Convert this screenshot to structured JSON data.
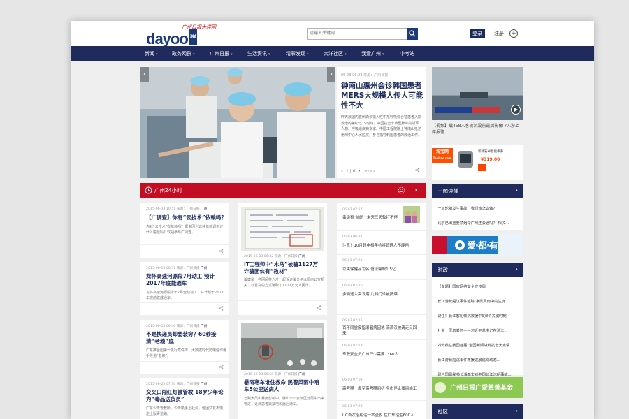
{
  "header": {
    "logo_top": "广州日报大洋网",
    "logo_main": "dayoo",
    "logo_badge": "测试",
    "search_placeholder": "请输入关键词...",
    "login_label": "登录",
    "register_label": "注册"
  },
  "nav": {
    "items": [
      {
        "label": "新闻",
        "dropdown": true
      },
      {
        "label": "政务网群",
        "dropdown": true
      },
      {
        "label": "广州日报",
        "dropdown": true
      },
      {
        "label": "生活资讯",
        "dropdown": true
      },
      {
        "label": "精彩发现",
        "dropdown": true
      },
      {
        "label": "大洋社区",
        "dropdown": true
      },
      {
        "label": "我爱广州",
        "dropdown": true
      },
      {
        "label": "中考站",
        "dropdown": false
      }
    ]
  },
  "feature": {
    "meta": "06-03 06:33 来源：广州日报",
    "headline": "钟南山惠州会诊韩国患者 MERS大规模人传人可能性不大",
    "summary": "昨天晨国内首例确诊输入性中东呼吸综合征患者入院救治的第6天。9时许，中国抗击非典型肺炎的领军人物、呼吸道疾病专家、中国工程院院士钟南山抵达惠州中心人民医院，参与指导韩国患者的救治工作。",
    "pager_current": "1",
    "pager_sep": "|",
    "pager_total": "6",
    "more_label": "more"
  },
  "video": {
    "caption": "【视频】载458人客轮沉没前最后影像 7人游上岸报警",
    "ad_brand": "淘宝网",
    "ad_domain": "Taobao.com",
    "ad_text": "新款安卓智能手表 ",
    "ad_price": "¥319.00"
  },
  "guangzhou24": {
    "title": "广州24小时",
    "cards": [
      {
        "meta": "2015-06-03 10:51 来源：广州日报",
        "badge": "广州",
        "title": "【广调查】你有“云技术”依赖吗？",
        "summary": "你对“云技术”有依赖吗？据说因为这种依赖遇到过什么尴尬吗？欢迎参与广调查。"
      },
      {
        "meta": "2015-06-03 06:57 来源：广州日报",
        "badge": "广州",
        "title": "龙怀高速河源段7月动工 预计2017年底能通车",
        "summary": "龙怀高速河源段今年7月全线动工，并计划于2017年底前建成通车。"
      },
      {
        "meta": "2015-06-03 06:46 来源：广州日报",
        "badge": "广州",
        "title": "不是快递员却要装穷？60秒接清“老赖”底",
        "summary": "广东推全国第一执行案件库，大数据时代防电信诈骗手段追“老赖”。"
      },
      {
        "meta": "2015-06-03 07:30 来源：广州日报",
        "badge": "广州",
        "title": "交叉口闯红灯被管教 18岁少年论为“毒品送货员”",
        "summary": "广东少年管教所，少年吸手上社会，他因交友不慎，走上贩毒道路。"
      }
    ],
    "photo_cards": [
      {
        "meta": "2015-06-03 06:42 来源：广州日报",
        "badge": "广州",
        "title": "IT工程师中“木马”被骗1127万 诈骗团伙有“教材”",
        "summary": "骗案是一名网民挂人才，起诉诈骗分子以国内公安机关，以冒充的方式骗取了1127万元人民币。"
      },
      {
        "meta": "2015-06-03 06:58 来源：广州日报",
        "badge": "广州",
        "title": "暴雨寒车谁住救命 民警风雨中哨车5公里送病人",
        "summary": "七贼大风和暴雨影响中，佛山市公安城区分局车出来管进，让病患者紧紧地和此后通车。"
      }
    ],
    "brief_items": [
      {
        "date": "06-03 07:17",
        "text": "雷锋有“加班” 未来三天较打不停"
      },
      {
        "date": "06-03 06:37",
        "text": "注意！10月起电梯年检将管理人不能用"
      },
      {
        "date": "06-03 07:28",
        "text": "以夹保健品为名 信法骗取1.5亿"
      },
      {
        "date": "06-03 07:26",
        "text": "多辆违入高发期 儿科门诊被挤爆"
      },
      {
        "date": "06-03 07:25",
        "text": "百年同堂废指滚者病因地 流浪汉被请走又回来"
      },
      {
        "date": "06-03 07:23",
        "text": "专职安全员广州三少需要1360人"
      },
      {
        "date": "06-03 07:09",
        "text": "高考期一周至高考期间初 全市停止夜间施工"
      },
      {
        "date": "06-03 07:08",
        "text": "UC首次借期达一本垄胶 在广东招生600人"
      }
    ]
  },
  "sidebar": {
    "tu_title": "一图读懂",
    "tu_items": [
      "一目轮船发生事故，我们该怎么做？",
      "北京已出重要禁烟令广州还会远吗？ 相关..."
    ],
    "shizheng_title": "时政",
    "shizheng_items": [
      "【专题】国家网络安全宣传周",
      "长江游轮船沉事件追踪:家属风雨中的生死...",
      "记住！长江客船倾沉救援中的8个关键时刻",
      "社会一匯息关怀——习近平总书记在浙江...",
      "刘奇葆在我国首届“全国新闻战线抗击大疫情...",
      "长江游轮船沉事件救援进展追踪动态...",
      "联合国副秘书长潘基文对中国长江沉船事故..."
    ],
    "banner_love": "爱·都·有",
    "banner_fund": "广州日报广爱慈善基金",
    "shequ_title": "社区"
  }
}
